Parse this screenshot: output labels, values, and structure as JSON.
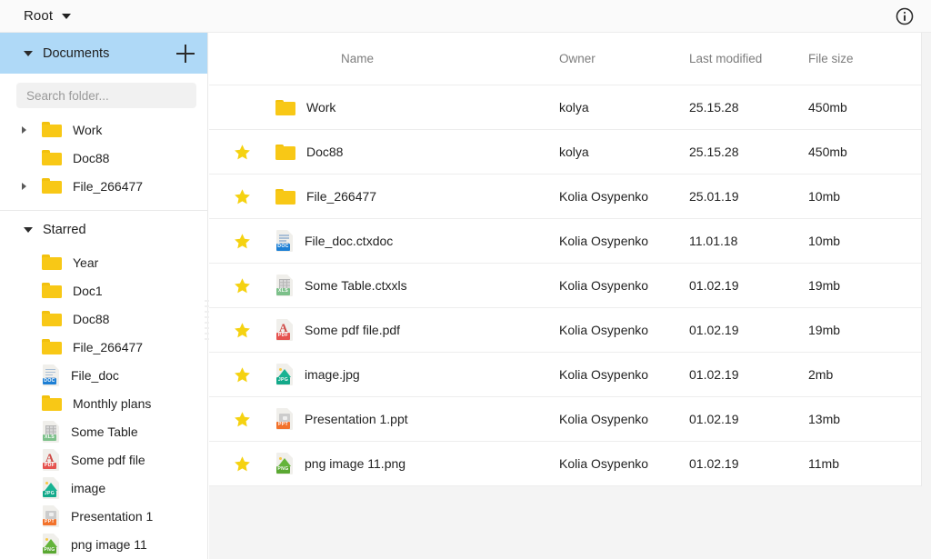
{
  "topbar": {
    "root_label": "Root",
    "caret_icon": "chevron-down-icon",
    "info_icon": "info-circle-icon"
  },
  "sidebar": {
    "documents": {
      "title": "Documents",
      "expanded": true,
      "add_icon": "plus-icon",
      "collapse_icon": "triangle-down-icon"
    },
    "search": {
      "placeholder": "Search folder...",
      "value": ""
    },
    "documents_items": [
      {
        "label": "Work",
        "icon": "folder-icon",
        "expandable": true
      },
      {
        "label": "Doc88",
        "icon": "folder-icon",
        "expandable": false
      },
      {
        "label": "File_266477",
        "icon": "folder-icon",
        "expandable": true
      }
    ],
    "starred": {
      "title": "Starred",
      "expanded": true,
      "collapse_icon": "triangle-down-icon"
    },
    "starred_items": [
      {
        "label": "Year",
        "icon": "folder-icon"
      },
      {
        "label": "Doc1",
        "icon": "folder-icon"
      },
      {
        "label": "Doc88",
        "icon": "folder-icon"
      },
      {
        "label": "File_266477",
        "icon": "folder-icon"
      },
      {
        "label": "File_doc",
        "icon": "doc-file-icon",
        "tag": "DOC"
      },
      {
        "label": "Monthly plans",
        "icon": "folder-icon"
      },
      {
        "label": "Some Table",
        "icon": "xls-file-icon",
        "tag": "XLS"
      },
      {
        "label": "Some pdf file",
        "icon": "pdf-file-icon",
        "tag": "PDF"
      },
      {
        "label": "image",
        "icon": "jpg-file-icon",
        "tag": "JPG"
      },
      {
        "label": "Presentation 1",
        "icon": "ppt-file-icon",
        "tag": "PPT"
      },
      {
        "label": "png image 11",
        "icon": "png-file-icon",
        "tag": "PNG"
      }
    ]
  },
  "table": {
    "columns": {
      "name": "Name",
      "owner": "Owner",
      "modified": "Last modified",
      "size": "File size"
    },
    "rows": [
      {
        "starred": false,
        "icon": "folder-icon",
        "tag": "",
        "name": "Work",
        "owner": "kolya",
        "modified": "25.15.28",
        "size": "450mb"
      },
      {
        "starred": true,
        "icon": "folder-icon",
        "tag": "",
        "name": "Doc88",
        "owner": "kolya",
        "modified": "25.15.28",
        "size": "450mb"
      },
      {
        "starred": true,
        "icon": "folder-icon",
        "tag": "",
        "name": "File_266477",
        "owner": "Kolia Osypenko",
        "modified": "25.01.19",
        "size": "10mb"
      },
      {
        "starred": true,
        "icon": "doc-file-icon",
        "tag": "DOC",
        "name": "File_doc.ctxdoc",
        "owner": "Kolia Osypenko",
        "modified": "11.01.18",
        "size": "10mb"
      },
      {
        "starred": true,
        "icon": "xls-file-icon",
        "tag": "XLS",
        "name": "Some Table.ctxxls",
        "owner": "Kolia Osypenko",
        "modified": "01.02.19",
        "size": "19mb"
      },
      {
        "starred": true,
        "icon": "pdf-file-icon",
        "tag": "PDF",
        "name": "Some pdf file.pdf",
        "owner": "Kolia Osypenko",
        "modified": "01.02.19",
        "size": "19mb"
      },
      {
        "starred": true,
        "icon": "jpg-file-icon",
        "tag": "JPG",
        "name": "image.jpg",
        "owner": "Kolia Osypenko",
        "modified": "01.02.19",
        "size": "2mb"
      },
      {
        "starred": true,
        "icon": "ppt-file-icon",
        "tag": "PPT",
        "name": "Presentation 1.ppt",
        "owner": "Kolia Osypenko",
        "modified": "01.02.19",
        "size": "13mb"
      },
      {
        "starred": true,
        "icon": "png-file-icon",
        "tag": "PNG",
        "name": "png image 11.png",
        "owner": "Kolia Osypenko",
        "modified": "01.02.19",
        "size": "11mb"
      }
    ]
  },
  "colors": {
    "folder": "#f8c816",
    "star": "#f5d211",
    "section_highlight": "#afd9f7",
    "text": "#232323",
    "muted": "#7d7d7d"
  }
}
